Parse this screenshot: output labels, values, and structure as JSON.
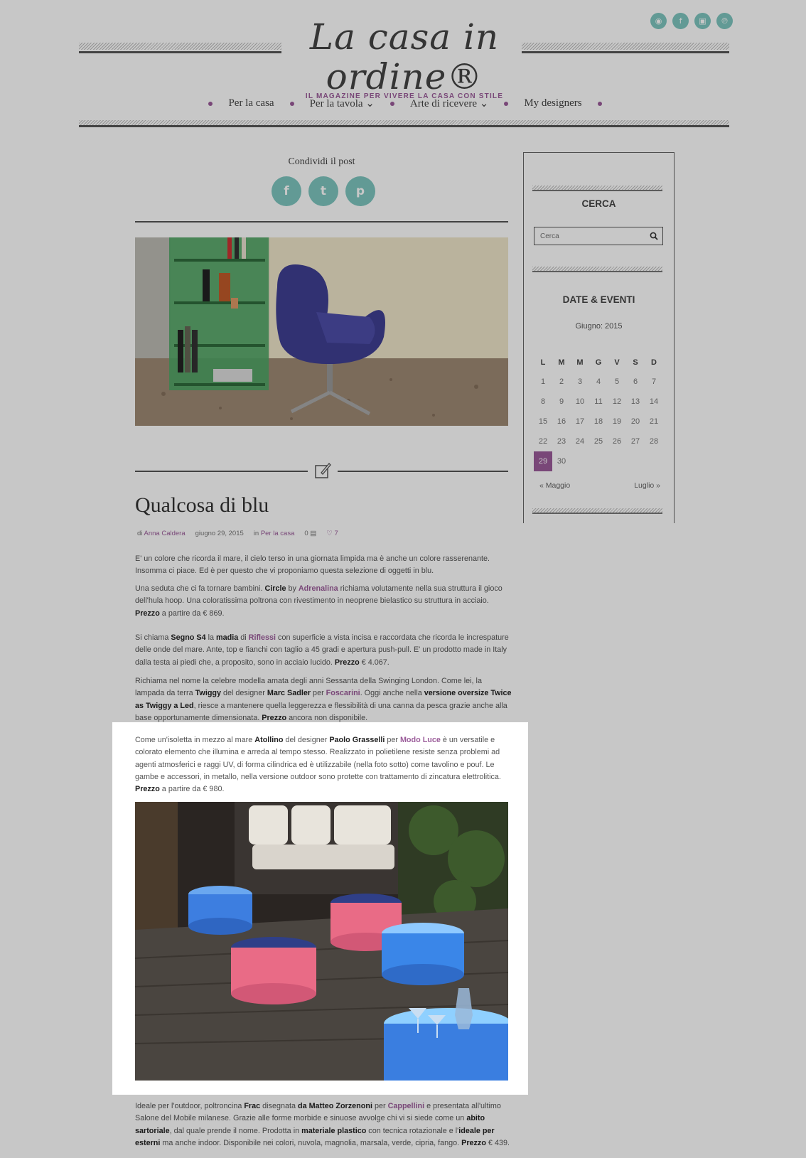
{
  "site": {
    "logo_text": "La casa in ordine®",
    "tagline": "IL MAGAZINE PER VIVERE LA CASA CON STILE",
    "social": [
      "rss-icon",
      "facebook-icon",
      "instagram-icon",
      "pinterest-icon"
    ]
  },
  "nav": {
    "items": [
      {
        "label": "Per la casa"
      },
      {
        "label": "Per la tavola ⌄"
      },
      {
        "label": "Arte di ricevere ⌄"
      },
      {
        "label": "My designers"
      }
    ]
  },
  "share": {
    "title": "Condividi il post"
  },
  "post": {
    "title": "Qualcosa di blu",
    "meta": {
      "author_prefix": "di",
      "author": "Anna Caldera",
      "date": "giugno 29, 2015",
      "category_prefix": "in",
      "category": "Per la casa",
      "comments": "0",
      "likes": "7"
    },
    "paragraphs": {
      "p1": "E' un colore che ricorda il mare, il cielo terso in una giornata limpida ma è anche un colore rasserenante. Insomma ci piace. Ed è per questo che vi proponiamo questa selezione di oggetti in blu.",
      "p2": [
        "Una seduta che ci fa tornare bambini. ",
        "Circle",
        " by ",
        "Adrenalina",
        " richiama volutamente nella sua struttura il gioco dell'hula hoop. Una coloratissima poltrona con rivestimento in neoprene bielastico su struttura in acciaio. ",
        "Prezzo",
        " a partire da € 869."
      ],
      "p3": [
        "Si chiama ",
        "Segno S4",
        " la ",
        "madia",
        " di ",
        "Riflessi",
        " con superficie a vista incisa e raccordata che ricorda le increspature delle onde del mare. Ante, top e fianchi con taglio a 45 gradi e apertura push-pull. E' un prodotto made in Italy dalla testa ai piedi che, a proposito, sono in acciaio lucido. ",
        "Prezzo",
        " € 4.067."
      ],
      "p4": [
        "Richiama nel nome la celebre modella amata degli anni Sessanta della Swinging London. Come lei, la lampada da terra ",
        "Twiggy",
        " del designer ",
        "Marc Sadler",
        " per ",
        "Foscarini",
        ". Oggi anche nella ",
        "versione oversize Twice as Twiggy a Led",
        ", riesce a mantenere quella leggerezza e flessibilità di una canna da pesca grazie anche alla base opportunamente dimensionata. ",
        "Prezzo",
        " ancora non disponibile."
      ],
      "p5": [
        "Come un'isoletta in mezzo al mare ",
        "Atollino",
        " del designer ",
        "Paolo Grasselli",
        " per ",
        "Modo Luce",
        " è un versatile e colorato elemento che illumina e arreda al tempo stesso. Realizzato in polietilene resiste senza problemi ad agenti atmosferici e raggi UV, di forma cilindrica ed è utilizzabile (nella foto sotto) come tavolino e pouf. Le gambe e accessori, in metallo, nella versione outdoor sono protette con trattamento di zincatura elettrolitica. ",
        "Prezzo",
        " a partire da € 980."
      ],
      "p6": [
        "Ideale per l'outdoor, poltroncina ",
        "Frac",
        " disegnata ",
        "da Matteo Zorzenoni",
        " per ",
        "Cappellini",
        " e presentata all'ultimo Salone del Mobile milanese. Grazie alle forme morbide e sinuose avvolge chi vi si siede come un ",
        "abito sartoriale",
        ", dal quale prende il nome. Prodotta in ",
        "materiale plastico",
        " con tecnica rotazionale e l'",
        "ideale per esterni",
        " ma anche indoor. Disponibile nei colori, nuvola, magnolia, marsala, verde, cipria, fango. ",
        "Prezzo",
        " € 439."
      ]
    }
  },
  "sidebar": {
    "search_title": "CERCA",
    "search_placeholder": "Cerca",
    "events_title": "DATE & EVENTI",
    "month": "Giugno: 2015",
    "weekdays": [
      "L",
      "M",
      "M",
      "G",
      "V",
      "S",
      "D"
    ],
    "weeks": [
      [
        "1",
        "2",
        "3",
        "4",
        "5",
        "6",
        "7"
      ],
      [
        "8",
        "9",
        "10",
        "11",
        "12",
        "13",
        "14"
      ],
      [
        "15",
        "16",
        "17",
        "18",
        "19",
        "20",
        "21"
      ],
      [
        "22",
        "23",
        "24",
        "25",
        "26",
        "27",
        "28"
      ],
      [
        "29",
        "30",
        "",
        "",
        "",
        "",
        ""
      ]
    ],
    "today": "29",
    "prev": "« Maggio",
    "next": "Luglio »"
  },
  "colors": {
    "accent": "#9b5c9a",
    "teal": "#7ec6bf",
    "dim_overlay": "rgba(0,0,0,0.22)"
  }
}
